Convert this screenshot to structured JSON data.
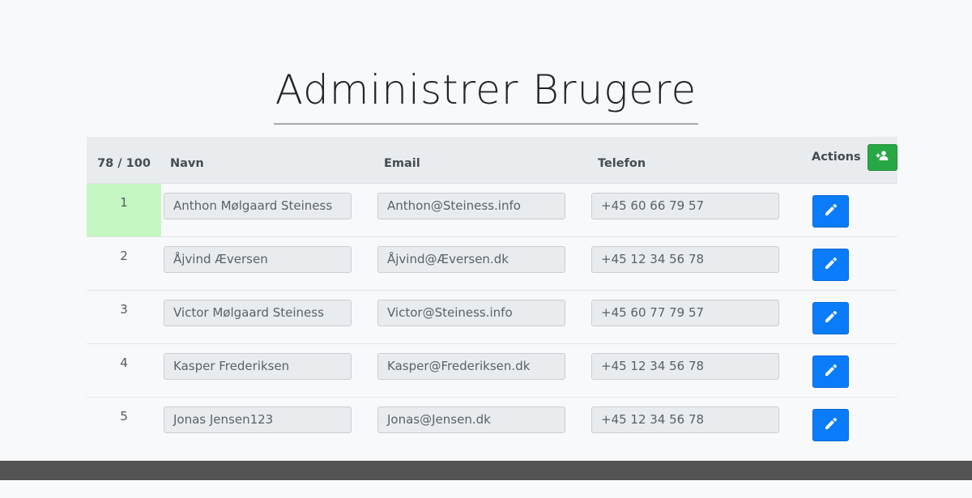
{
  "page": {
    "title": "Administrer Brugere"
  },
  "table": {
    "headers": {
      "count": "78 / 100",
      "name": "Navn",
      "email": "Email",
      "phone": "Telefon",
      "actions": "Actions"
    },
    "rows": [
      {
        "num": "1",
        "name": "Anthon Mølgaard Steiness",
        "email": "Anthon@Steiness.info",
        "phone": "+45 60 66 79 57",
        "highlighted": true
      },
      {
        "num": "2",
        "name": "Åjvind Æversen",
        "email": "Åjvind@Æversen.dk",
        "phone": "+45 12 34 56 78",
        "highlighted": false
      },
      {
        "num": "3",
        "name": "Victor Mølgaard Steiness",
        "email": "Victor@Steiness.info",
        "phone": "+45 60 77 79 57",
        "highlighted": false
      },
      {
        "num": "4",
        "name": "Kasper Frederiksen",
        "email": "Kasper@Frederiksen.dk",
        "phone": "+45 12 34 56 78",
        "highlighted": false
      },
      {
        "num": "5",
        "name": "Jonas Jensen123",
        "email": "Jonas@Jensen.dk",
        "phone": "+45 12 34 56 78",
        "highlighted": false
      }
    ]
  },
  "icons": {
    "add_user": "user-plus-icon",
    "edit": "pencil-icon"
  },
  "colors": {
    "add_button": "#28a745",
    "edit_button": "#0a7cf9",
    "highlight_row": "#c5f7c2",
    "footer": "#545454"
  }
}
